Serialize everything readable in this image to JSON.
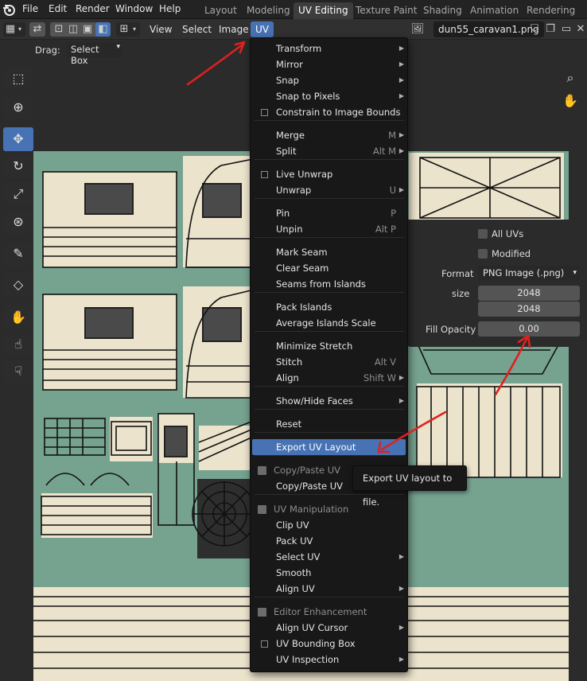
{
  "menubar": {
    "items": [
      "File",
      "Edit",
      "Render",
      "Window",
      "Help"
    ],
    "workspaces": [
      "Layout",
      "Modeling",
      "UV Editing",
      "Texture Paint",
      "Shading",
      "Animation",
      "Rendering"
    ],
    "active_workspace": "UV Editing"
  },
  "uv_header": {
    "menus": [
      "View",
      "Select",
      "Image",
      "UV"
    ],
    "active_menu": "UV",
    "image_name": "dun55_caravan1.png"
  },
  "tool_settings": {
    "drag_label": "Drag:",
    "drag_value": "Select Box"
  },
  "uv_menu": {
    "items": [
      {
        "label": "Transform",
        "submenu": true
      },
      {
        "label": "Mirror",
        "submenu": true
      },
      {
        "label": "Snap",
        "submenu": true
      },
      {
        "label": "Snap to Pixels",
        "submenu": true
      },
      {
        "label": "Constrain to Image Bounds",
        "checkbox": true
      },
      {
        "label": "Merge",
        "shortcut": "M",
        "submenu": true
      },
      {
        "label": "Split",
        "shortcut": "Alt M",
        "submenu": true
      },
      {
        "label": "Live Unwrap",
        "checkbox": true
      },
      {
        "label": "Unwrap",
        "shortcut": "U",
        "submenu": true
      },
      {
        "label": "Pin",
        "shortcut": "P"
      },
      {
        "label": "Unpin",
        "shortcut": "Alt P"
      },
      {
        "label": "Mark Seam"
      },
      {
        "label": "Clear Seam"
      },
      {
        "label": "Seams from Islands"
      },
      {
        "label": "Pack Islands"
      },
      {
        "label": "Average Islands Scale"
      },
      {
        "label": "Minimize Stretch"
      },
      {
        "label": "Stitch",
        "shortcut": "Alt V"
      },
      {
        "label": "Align",
        "shortcut": "Shift W",
        "submenu": true
      },
      {
        "label": "Show/Hide Faces",
        "submenu": true
      },
      {
        "label": "Reset"
      },
      {
        "label": "Export UV Layout",
        "highlighted": true
      },
      {
        "label": "Copy/Paste UV",
        "header": true
      },
      {
        "label": "Copy/Paste UV"
      },
      {
        "label": "UV Manipulation",
        "header": true
      },
      {
        "label": "Clip UV"
      },
      {
        "label": "Pack UV"
      },
      {
        "label": "Select UV",
        "submenu": true
      },
      {
        "label": "Smooth"
      },
      {
        "label": "Align UV",
        "submenu": true
      },
      {
        "label": "Editor Enhancement",
        "header": true
      },
      {
        "label": "Align UV Cursor",
        "submenu": true
      },
      {
        "label": "UV Bounding Box",
        "checkbox": true
      },
      {
        "label": "UV Inspection",
        "submenu": true
      }
    ]
  },
  "tooltip": {
    "text": "Export UV layout to file."
  },
  "export_panel": {
    "all_uvs_label": "All UVs",
    "modified_label": "Modified",
    "format_label": "Format",
    "format_value": "PNG Image (.png)",
    "size_label": "size",
    "size_x": "2048",
    "size_y": "2048",
    "fill_opacity_label": "Fill Opacity",
    "fill_opacity_value": "0.00"
  },
  "colors": {
    "accent": "#4772b3",
    "texture_bg": "#76a290",
    "annotation": "#e02020"
  }
}
